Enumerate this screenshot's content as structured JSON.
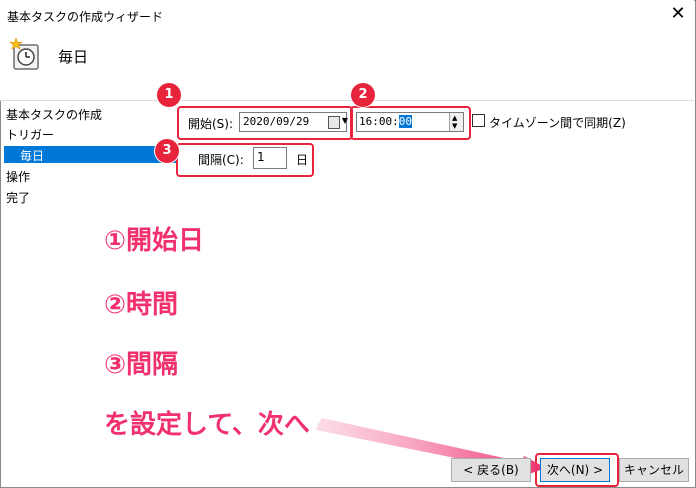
{
  "window": {
    "title": "基本タスクの作成ウィザード",
    "close_glyph": "✕"
  },
  "header": {
    "title": "毎日"
  },
  "nav": {
    "items": [
      {
        "label": "基本タスクの作成"
      },
      {
        "label": "トリガー"
      },
      {
        "label": "毎日",
        "selected": true
      },
      {
        "label": "操作"
      },
      {
        "label": "完了"
      }
    ]
  },
  "form": {
    "start_label": "開始(S):",
    "start_date": "2020/09/29",
    "start_time_prefix": "16:00:",
    "start_time_selected": "00",
    "sync_timezone_label": "タイムゾーン間で同期(Z)",
    "sync_timezone_checked": false,
    "interval_label": "間隔(C):",
    "interval_value": "1",
    "interval_unit": "日"
  },
  "callouts": {
    "badge1": "1",
    "badge2": "2",
    "badge3": "3"
  },
  "annotation": {
    "line1": "①開始日",
    "line2": "②時間",
    "line3": "③間隔",
    "line4": "を設定して、次へ"
  },
  "buttons": {
    "back": "< 戻る(B)",
    "next": "次へ(N) >",
    "cancel": "キャンセル"
  },
  "colors": {
    "accent_red": "#e8243c",
    "annotation_pink": "#f0316e",
    "selection_blue": "#0078d7"
  }
}
